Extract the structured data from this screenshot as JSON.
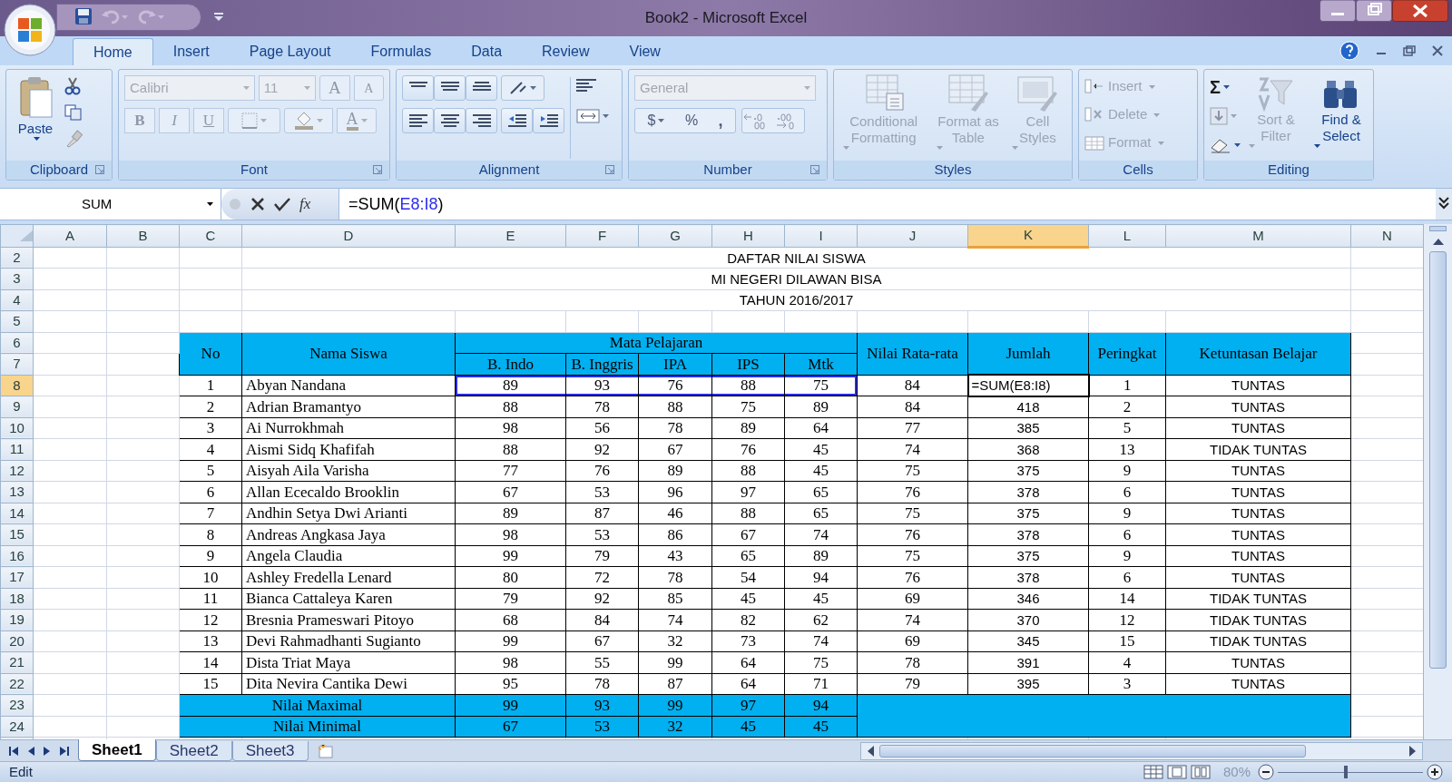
{
  "window": {
    "title": "Book2 - Microsoft Excel"
  },
  "ribbon_tabs": [
    {
      "label": "Home",
      "selected": true
    },
    {
      "label": "Insert",
      "selected": false
    },
    {
      "label": "Page Layout",
      "selected": false
    },
    {
      "label": "Formulas",
      "selected": false
    },
    {
      "label": "Data",
      "selected": false
    },
    {
      "label": "Review",
      "selected": false
    },
    {
      "label": "View",
      "selected": false
    }
  ],
  "ribbon": {
    "clipboard": {
      "paste": "Paste",
      "label": "Clipboard"
    },
    "font": {
      "font_name": "Calibri",
      "font_size": "11",
      "grow": "A",
      "shrink": "A",
      "bold": "B",
      "italic": "I",
      "underline": "U",
      "font_color": "A",
      "label": "Font"
    },
    "alignment": {
      "label": "Alignment"
    },
    "number": {
      "format": "General",
      "currency": "$",
      "percent": "%",
      "comma": ",",
      "label": "Number"
    },
    "styles": {
      "buttons": [
        {
          "label": "Conditional Formatting",
          "disabled": true
        },
        {
          "label": "Format as Table",
          "disabled": true
        },
        {
          "label": "Cell Styles",
          "disabled": true
        }
      ],
      "label": "Styles"
    },
    "cells": {
      "buttons": [
        {
          "label": "Insert",
          "disabled": true
        },
        {
          "label": "Delete",
          "disabled": true
        },
        {
          "label": "Format",
          "disabled": true
        }
      ],
      "label": "Cells"
    },
    "editing": {
      "autosum": "Σ",
      "buttons": [
        {
          "label": "Sort & Filter",
          "disabled": true
        },
        {
          "label": "Find & Select",
          "disabled": false
        }
      ],
      "label": "Editing"
    }
  },
  "formula_bar": {
    "name_box": "SUM",
    "function_button": "fx",
    "formula": {
      "start": "=SUM(",
      "reference": "E8:I8",
      "end": ")"
    }
  },
  "column_headers": [
    {
      "label": "A",
      "selected": false
    },
    {
      "label": "B",
      "selected": false
    },
    {
      "label": "C",
      "selected": false
    },
    {
      "label": "D",
      "selected": false
    },
    {
      "label": "E",
      "selected": false
    },
    {
      "label": "F",
      "selected": false
    },
    {
      "label": "G",
      "selected": false
    },
    {
      "label": "H",
      "selected": false
    },
    {
      "label": "I",
      "selected": false
    },
    {
      "label": "J",
      "selected": false
    },
    {
      "label": "K",
      "selected": true
    },
    {
      "label": "L",
      "selected": false
    },
    {
      "label": "M",
      "selected": false
    },
    {
      "label": "N",
      "selected": false
    }
  ],
  "row_headers": [
    {
      "label": "2",
      "selected": false
    },
    {
      "label": "3",
      "selected": false
    },
    {
      "label": "4",
      "selected": false
    },
    {
      "label": "5",
      "selected": false
    },
    {
      "label": "6",
      "selected": false
    },
    {
      "label": "7",
      "selected": false
    },
    {
      "label": "8",
      "selected": true
    },
    {
      "label": "9",
      "selected": false
    },
    {
      "label": "10",
      "selected": false
    },
    {
      "label": "11",
      "selected": false
    },
    {
      "label": "12",
      "selected": false
    },
    {
      "label": "13",
      "selected": false
    },
    {
      "label": "14",
      "selected": false
    },
    {
      "label": "15",
      "selected": false
    },
    {
      "label": "16",
      "selected": false
    },
    {
      "label": "17",
      "selected": false
    },
    {
      "label": "18",
      "selected": false
    },
    {
      "label": "19",
      "selected": false
    },
    {
      "label": "20",
      "selected": false
    },
    {
      "label": "21",
      "selected": false
    },
    {
      "label": "22",
      "selected": false
    },
    {
      "label": "23",
      "selected": false
    },
    {
      "label": "24",
      "selected": false
    }
  ],
  "sheet": {
    "titles": [
      "DAFTAR NILAI SISWA",
      "MI NEGERI DILAWAN BISA",
      "TAHUN 2016/2017"
    ],
    "header": {
      "no": "No",
      "name": "Nama Siswa",
      "subject_group": "Mata Pelajaran",
      "subjects": [
        "B. Indo",
        "B. Inggris",
        "IPA",
        "IPS",
        "Mtk"
      ],
      "average": "Nilai Rata-rata",
      "total": "Jumlah",
      "rank": "Peringkat",
      "status": "Ketuntasan Belajar"
    },
    "students": [
      {
        "no": "1",
        "name": "Abyan Nandana",
        "scores": [
          "89",
          "93",
          "76",
          "88",
          "75"
        ],
        "average": "84",
        "total": "=SUM(E8:I8)",
        "rank": "1",
        "status": "TUNTAS",
        "editing": true
      },
      {
        "no": "2",
        "name": "Adrian Bramantyo",
        "scores": [
          "88",
          "78",
          "88",
          "75",
          "89"
        ],
        "average": "84",
        "total": "418",
        "rank": "2",
        "status": "TUNTAS",
        "editing": false
      },
      {
        "no": "3",
        "name": "Ai Nurrokhmah",
        "scores": [
          "98",
          "56",
          "78",
          "89",
          "64"
        ],
        "average": "77",
        "total": "385",
        "rank": "5",
        "status": "TUNTAS",
        "editing": false
      },
      {
        "no": "4",
        "name": "Aismi Sidq Khafifah",
        "scores": [
          "88",
          "92",
          "67",
          "76",
          "45"
        ],
        "average": "74",
        "total": "368",
        "rank": "13",
        "status": "TIDAK TUNTAS",
        "editing": false
      },
      {
        "no": "5",
        "name": "Aisyah Aila Varisha",
        "scores": [
          "77",
          "76",
          "89",
          "88",
          "45"
        ],
        "average": "75",
        "total": "375",
        "rank": "9",
        "status": "TUNTAS",
        "editing": false
      },
      {
        "no": "6",
        "name": "Allan Ececaldo Brooklin",
        "scores": [
          "67",
          "53",
          "96",
          "97",
          "65"
        ],
        "average": "76",
        "total": "378",
        "rank": "6",
        "status": "TUNTAS",
        "editing": false
      },
      {
        "no": "7",
        "name": "Andhin Setya Dwi Arianti",
        "scores": [
          "89",
          "87",
          "46",
          "88",
          "65"
        ],
        "average": "75",
        "total": "375",
        "rank": "9",
        "status": "TUNTAS",
        "editing": false
      },
      {
        "no": "8",
        "name": "Andreas Angkasa Jaya",
        "scores": [
          "98",
          "53",
          "86",
          "67",
          "74"
        ],
        "average": "76",
        "total": "378",
        "rank": "6",
        "status": "TUNTAS",
        "editing": false
      },
      {
        "no": "9",
        "name": "Angela Claudia",
        "scores": [
          "99",
          "79",
          "43",
          "65",
          "89"
        ],
        "average": "75",
        "total": "375",
        "rank": "9",
        "status": "TUNTAS",
        "editing": false
      },
      {
        "no": "10",
        "name": "Ashley Fredella Lenard",
        "scores": [
          "80",
          "72",
          "78",
          "54",
          "94"
        ],
        "average": "76",
        "total": "378",
        "rank": "6",
        "status": "TUNTAS",
        "editing": false
      },
      {
        "no": "11",
        "name": "Bianca Cattaleya Karen",
        "scores": [
          "79",
          "92",
          "85",
          "45",
          "45"
        ],
        "average": "69",
        "total": "346",
        "rank": "14",
        "status": "TIDAK TUNTAS",
        "editing": false
      },
      {
        "no": "12",
        "name": "Bresnia Prameswari Pitoyo",
        "scores": [
          "68",
          "84",
          "74",
          "82",
          "62"
        ],
        "average": "74",
        "total": "370",
        "rank": "12",
        "status": "TIDAK TUNTAS",
        "editing": false
      },
      {
        "no": "13",
        "name": "Devi Rahmadhanti Sugianto",
        "scores": [
          "99",
          "67",
          "32",
          "73",
          "74"
        ],
        "average": "69",
        "total": "345",
        "rank": "15",
        "status": "TIDAK TUNTAS",
        "editing": false
      },
      {
        "no": "14",
        "name": "Dista Triat Maya",
        "scores": [
          "98",
          "55",
          "99",
          "64",
          "75"
        ],
        "average": "78",
        "total": "391",
        "rank": "4",
        "status": "TUNTAS",
        "editing": false
      },
      {
        "no": "15",
        "name": "Dita Nevira Cantika Dewi",
        "scores": [
          "95",
          "78",
          "87",
          "64",
          "71"
        ],
        "average": "79",
        "total": "395",
        "rank": "3",
        "status": "TUNTAS",
        "editing": false
      }
    ],
    "summary": [
      {
        "label": "Nilai Maximal",
        "values": [
          "99",
          "93",
          "99",
          "97",
          "94"
        ]
      },
      {
        "label": "Nilai Minimal",
        "values": [
          "67",
          "53",
          "32",
          "45",
          "45"
        ]
      }
    ]
  },
  "sheet_tabs": [
    {
      "label": "Sheet1",
      "selected": true
    },
    {
      "label": "Sheet2",
      "selected": false
    },
    {
      "label": "Sheet3",
      "selected": false
    }
  ],
  "status_bar": {
    "mode": "Edit",
    "zoom": "80%",
    "zoom_slider": {
      "level": 0.47
    }
  }
}
